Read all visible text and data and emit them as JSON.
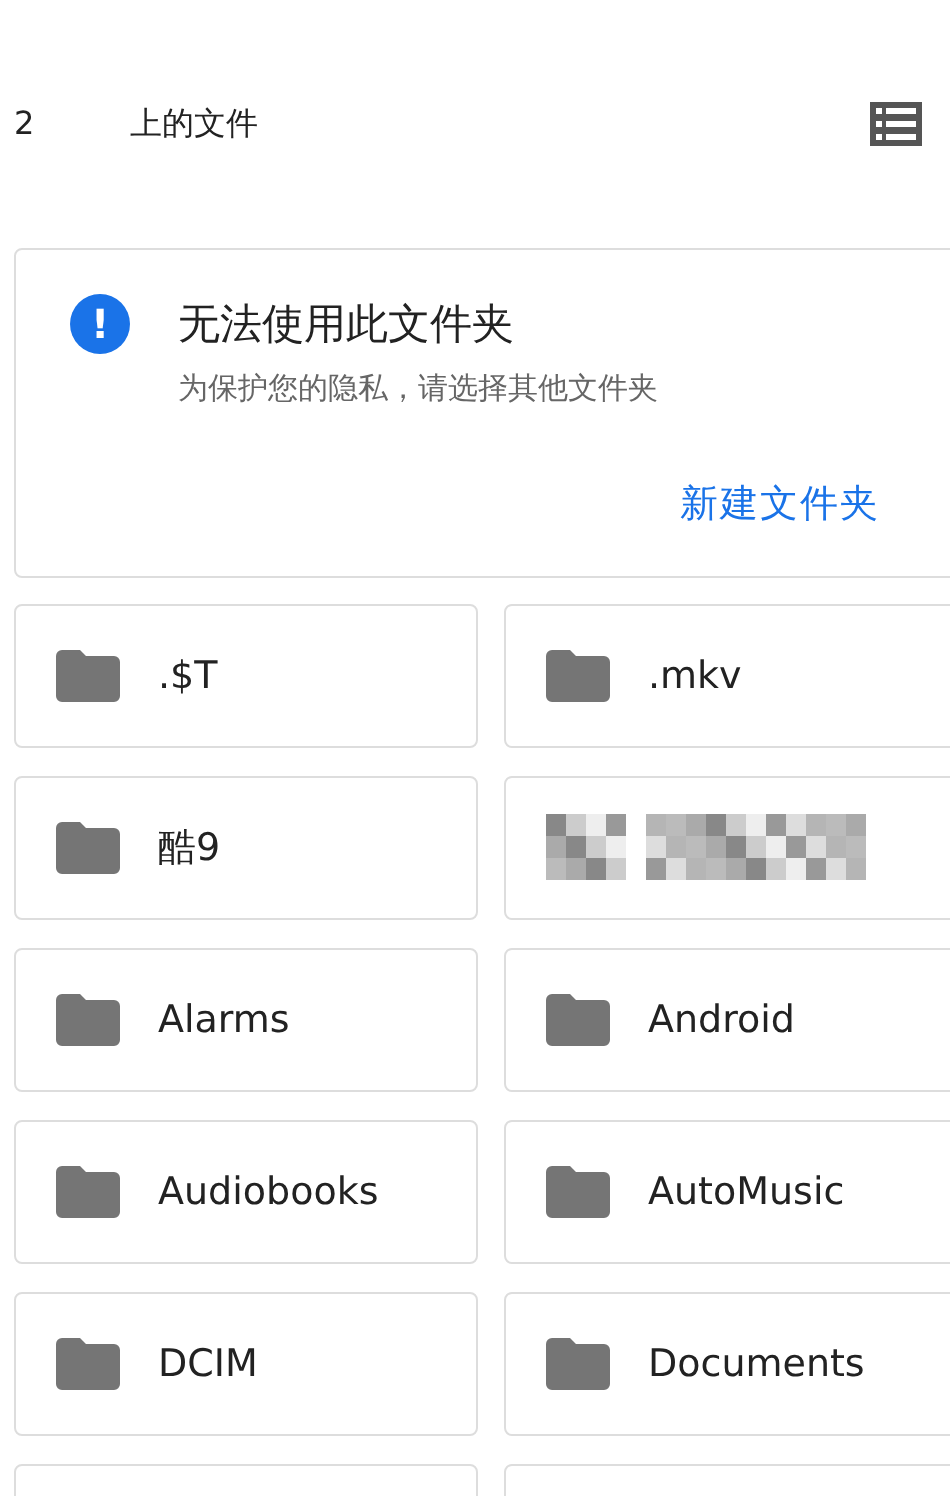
{
  "header": {
    "title_start": "2",
    "title_end": "上的文件"
  },
  "notice": {
    "icon": "!",
    "title": "无法使用此文件夹",
    "subtitle": "为保护您的隐私，请选择其他文件夹",
    "action": "新建文件夹"
  },
  "folders": [
    {
      "kind": "folder",
      "name": ".$T"
    },
    {
      "kind": "folder",
      "name": ".mkv"
    },
    {
      "kind": "folder",
      "name": "酷9"
    },
    {
      "kind": "blurred"
    },
    {
      "kind": "folder",
      "name": "Alarms"
    },
    {
      "kind": "folder",
      "name": "Android"
    },
    {
      "kind": "folder",
      "name": "Audiobooks"
    },
    {
      "kind": "folder",
      "name": "AutoMusic"
    },
    {
      "kind": "folder",
      "name": "DCIM"
    },
    {
      "kind": "folder",
      "name": "Documents"
    },
    {
      "kind": "empty"
    },
    {
      "kind": "empty"
    }
  ]
}
